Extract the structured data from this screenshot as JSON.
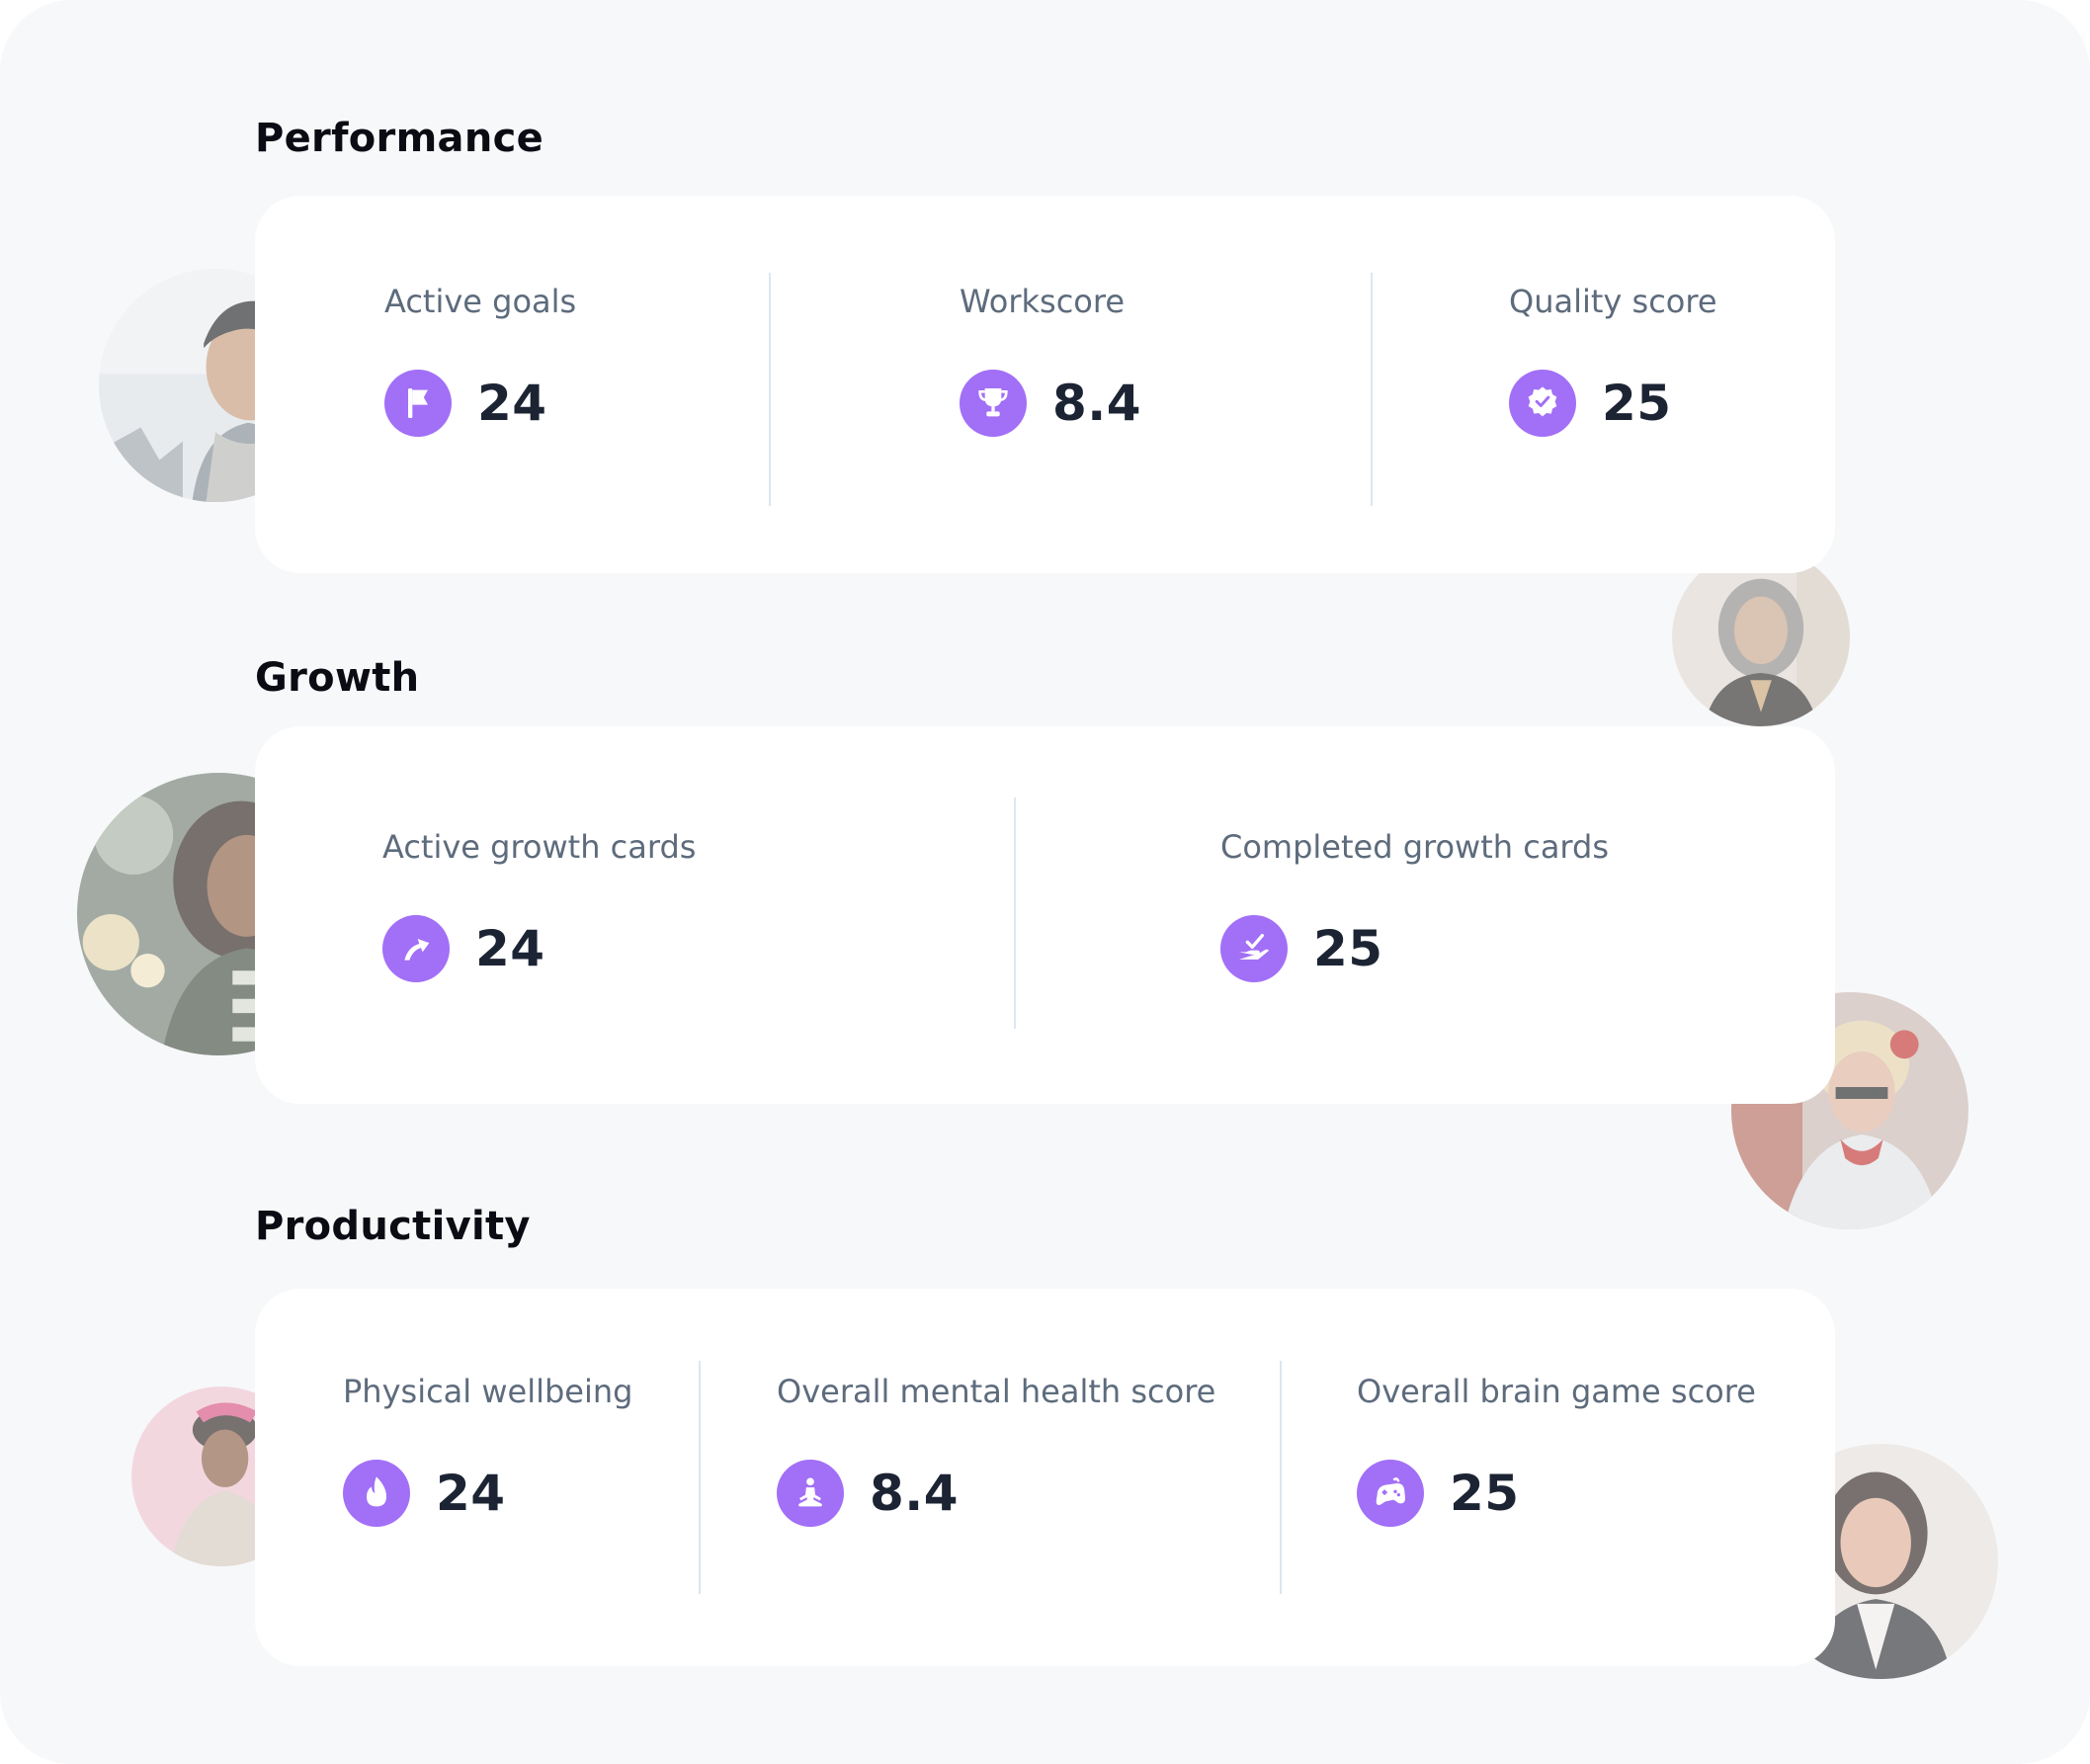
{
  "colors": {
    "accent": "#a26ff7",
    "card": "#ffffff",
    "background": "#f7f8fa",
    "divider": "#dde6f1"
  },
  "sections": {
    "performance": {
      "title": "Performance",
      "stats": [
        {
          "label": "Active goals",
          "value": "24",
          "icon": "flag-icon"
        },
        {
          "label": "Workscore",
          "value": "8.4",
          "icon": "trophy-icon"
        },
        {
          "label": "Quality score",
          "value": "25",
          "icon": "verified-badge-icon"
        }
      ]
    },
    "growth": {
      "title": "Growth",
      "stats": [
        {
          "label": "Active growth cards",
          "value": "24",
          "icon": "growth-arrow-icon"
        },
        {
          "label": "Completed growth cards",
          "value": "25",
          "icon": "hand-check-icon"
        }
      ]
    },
    "productivity": {
      "title": "Productivity",
      "stats": [
        {
          "label": "Physical wellbeing",
          "value": "24",
          "icon": "flame-icon"
        },
        {
          "label": "Overall mental health score",
          "value": "8.4",
          "icon": "meditation-icon"
        },
        {
          "label": "Overall brain game score",
          "value": "25",
          "icon": "gamepad-icon"
        }
      ]
    }
  },
  "avatars": [
    "avatar-photo",
    "avatar-photo",
    "avatar-photo",
    "avatar-photo",
    "avatar-photo",
    "avatar-photo"
  ]
}
